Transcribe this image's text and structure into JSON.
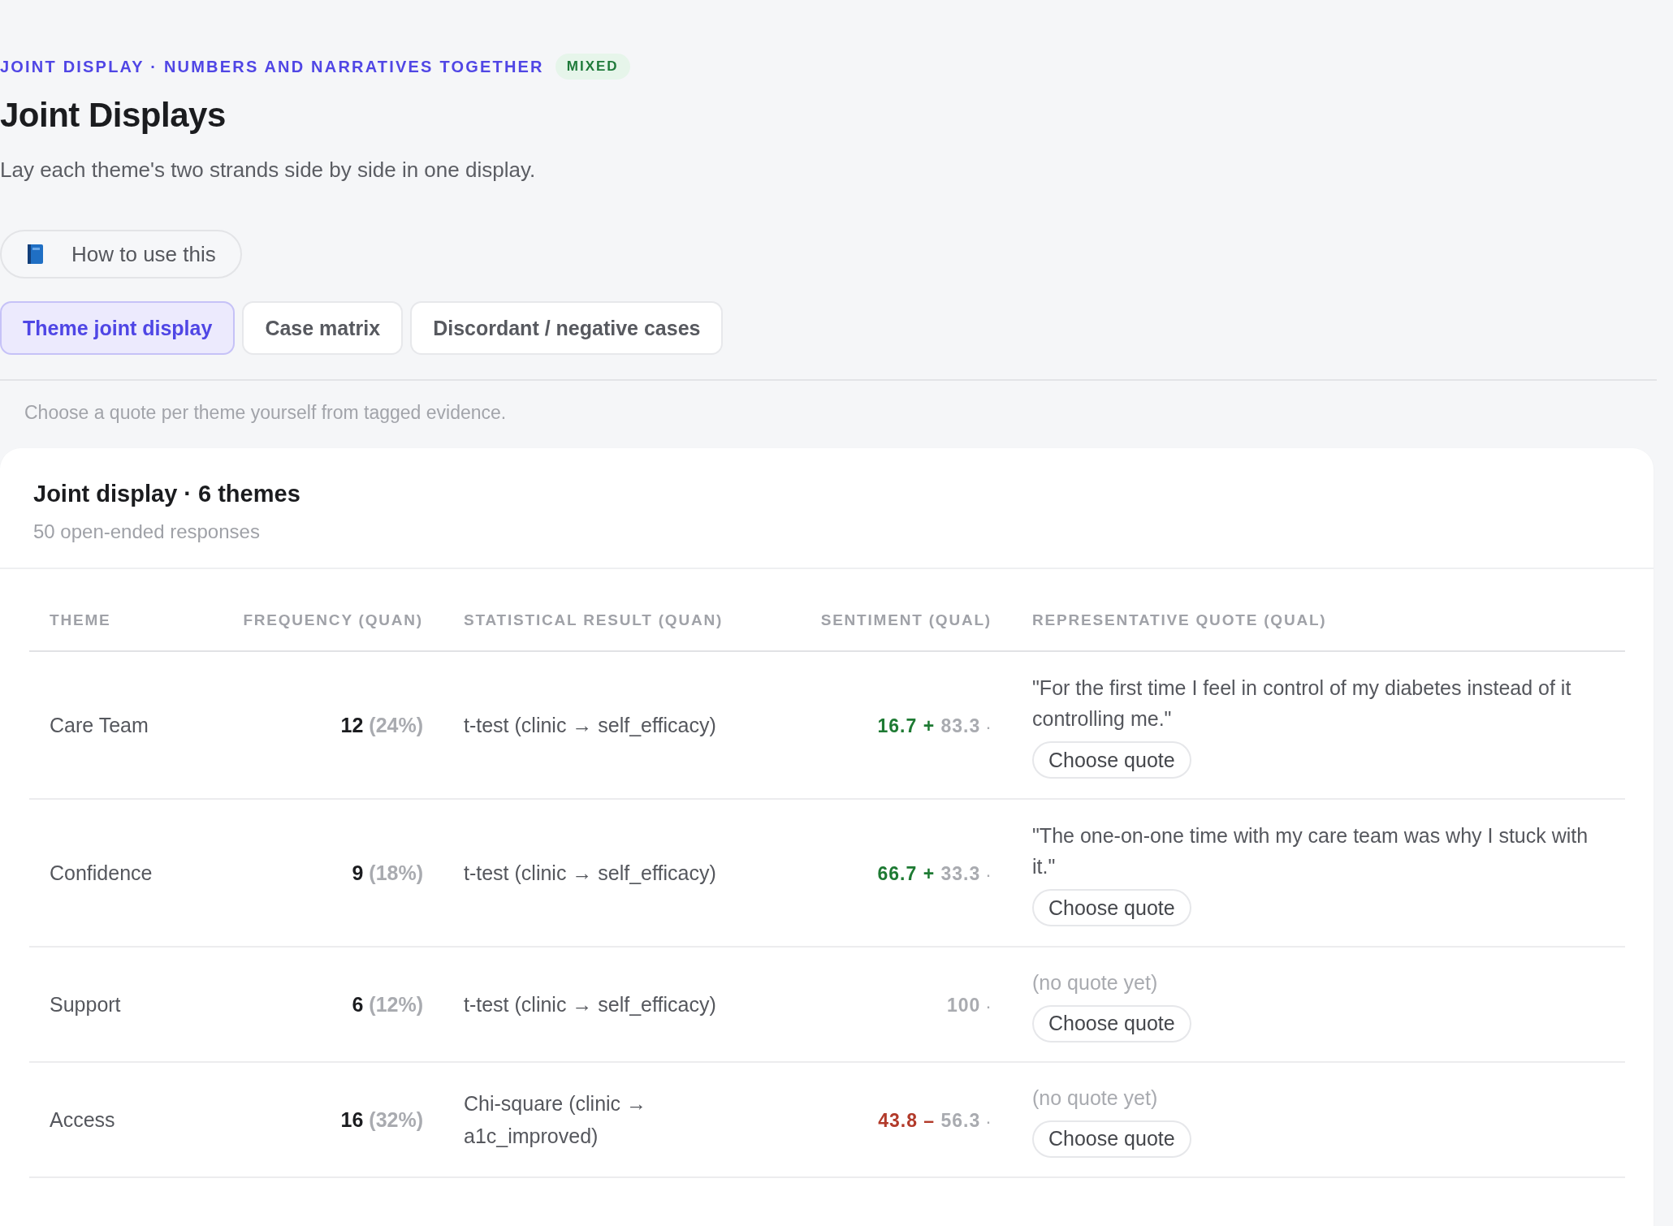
{
  "eyebrow": "JOINT DISPLAY · NUMBERS AND NARRATIVES TOGETHER",
  "badge": "MIXED",
  "title": "Joint Displays",
  "subtitle": "Lay each theme's two strands side by side in one display.",
  "help_button": "How to use this",
  "tabs": [
    {
      "label": "Theme joint display",
      "selected": true
    },
    {
      "label": "Case matrix",
      "selected": false
    },
    {
      "label": "Discordant / negative cases",
      "selected": false
    }
  ],
  "hint": "Choose a quote per theme yourself from tagged evidence.",
  "card": {
    "title": "Joint display · 6 themes",
    "subtitle": "50 open-ended responses",
    "table": {
      "columns": [
        "THEME",
        "FREQUENCY (QUAN)",
        "STATISTICAL RESULT (QUAN)",
        "SENTIMENT (QUAL)",
        "REPRESENTATIVE QUOTE (QUAL)"
      ],
      "rows": [
        {
          "theme": "Care Team",
          "count": "12",
          "percent": "(24%)",
          "stat": "t-test (clinic → self_efficacy)",
          "sentiment": {
            "color": "#1e7a33",
            "primary": "16.7",
            "sign": "+",
            "secondary": "83.3",
            "dot": "·"
          },
          "quote": {
            "kind": "quote",
            "text": "\"For the first time I feel in control of my diabetes instead of it controlling me.\""
          },
          "button": "Choose quote"
        },
        {
          "theme": "Confidence",
          "count": "9",
          "percent": "(18%)",
          "stat": "t-test (clinic → self_efficacy)",
          "sentiment": {
            "color": "#1e7a33",
            "primary": "66.7",
            "sign": "+",
            "secondary": "33.3",
            "dot": "·"
          },
          "quote": {
            "kind": "quote",
            "text": "\"The one-on-one time with my care team was why I stuck with it.\""
          },
          "button": "Choose quote"
        },
        {
          "theme": "Support",
          "count": "6",
          "percent": "(12%)",
          "stat": "t-test (clinic → self_efficacy)",
          "sentiment": {
            "color": "#a9abb0",
            "primary": "100",
            "dot": "·"
          },
          "quote": {
            "kind": "empty",
            "text": "(no quote yet)"
          },
          "button": "Choose quote"
        },
        {
          "theme": "Access",
          "count": "16",
          "percent": "(32%)",
          "stat": "Chi-square (clinic → a1c_improved)",
          "sentiment": {
            "color": "#b23a2a",
            "primary": "43.8",
            "sign": "–",
            "secondary": "56.3",
            "dot": "·"
          },
          "quote": {
            "kind": "empty",
            "text": "(no quote yet)"
          },
          "button": "Choose quote"
        }
      ]
    }
  }
}
